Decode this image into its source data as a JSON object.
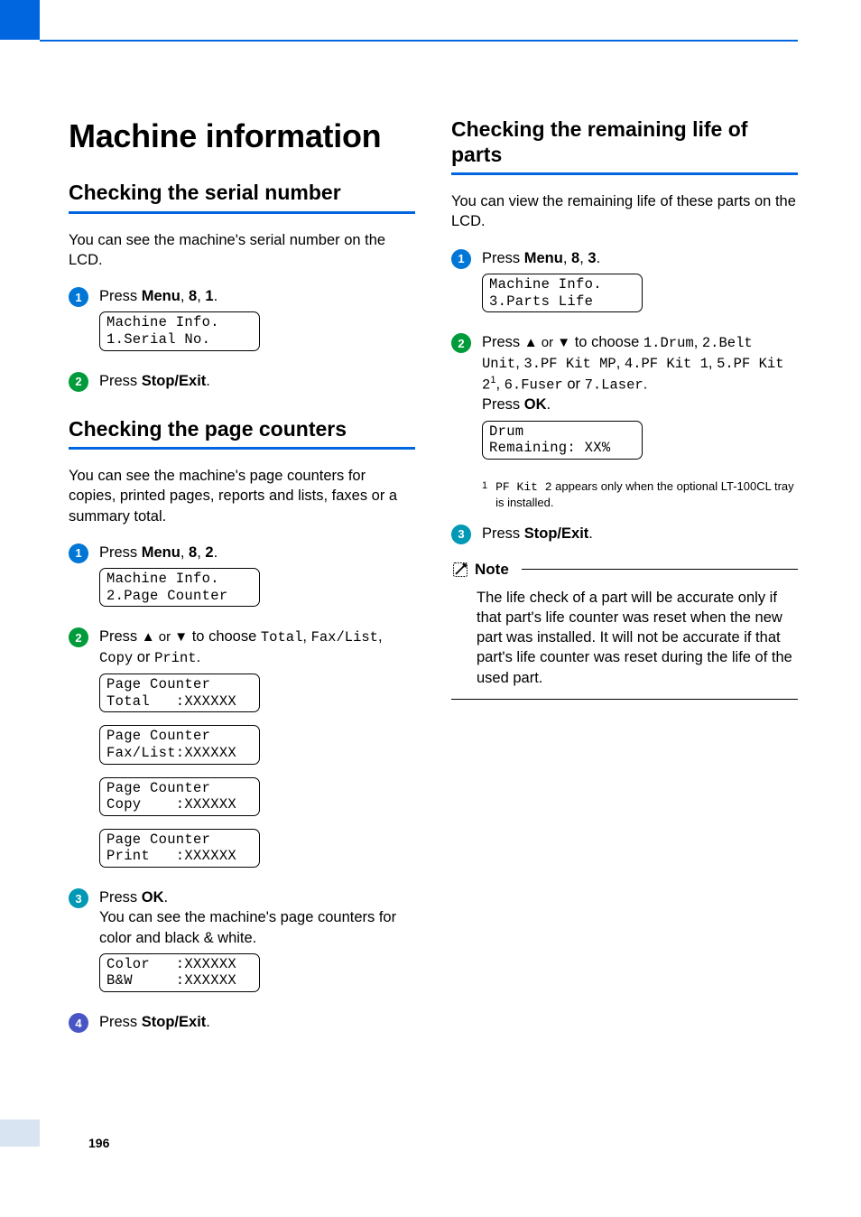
{
  "pageNumber": "196",
  "left": {
    "h1": "Machine information",
    "section1": {
      "title": "Checking the serial number",
      "intro": "You can see the machine's serial number on the LCD.",
      "step1_pre": "Press ",
      "step1_b1": "Menu",
      "step1_mid1": ", ",
      "step1_b2": "8",
      "step1_mid2": ", ",
      "step1_b3": "1",
      "step1_post": ".",
      "lcd1": "Machine Info.\n1.Serial No.",
      "step2_pre": "Press ",
      "step2_b": "Stop/Exit",
      "step2_post": "."
    },
    "section2": {
      "title": "Checking the page counters",
      "intro": "You can see the machine's page counters for copies, printed pages, reports and lists, faxes or a summary total.",
      "s1_pre": "Press ",
      "s1_b1": "Menu",
      "s1_m1": ", ",
      "s1_b2": "8",
      "s1_m2": ", ",
      "s1_b3": "2",
      "s1_post": ".",
      "lcd1": "Machine Info.\n2.Page Counter",
      "s2_pre": "Press ",
      "s2_arrows": "▲ or ▼",
      "s2_mid": " to choose ",
      "s2_o1": "Total",
      "s2_c1": ", ",
      "s2_o2": "Fax/List",
      "s2_c2": ", ",
      "s2_o3": "Copy",
      "s2_or": " or ",
      "s2_o4": "Print",
      "s2_post": ".",
      "lcd2": "Page Counter\nTotal   :XXXXXX",
      "lcd3": "Page Counter\nFax/List:XXXXXX",
      "lcd4": "Page Counter\nCopy    :XXXXXX",
      "lcd5": "Page Counter\nPrint   :XXXXXX",
      "s3_pre": "Press ",
      "s3_b": "OK",
      "s3_post": ".",
      "s3_line2": "You can see the machine's page counters for color and black & white.",
      "lcd6": "Color   :XXXXXX\nB&W     :XXXXXX",
      "s4_pre": "Press ",
      "s4_b": "Stop/Exit",
      "s4_post": "."
    }
  },
  "right": {
    "section": {
      "title": "Checking the remaining life of parts",
      "intro": "You can view the remaining life of these parts on the LCD.",
      "s1_pre": "Press ",
      "s1_b1": "Menu",
      "s1_m1": ", ",
      "s1_b2": "8",
      "s1_m2": ", ",
      "s1_b3": "3",
      "s1_post": ".",
      "lcd1": "Machine Info.\n3.Parts Life",
      "s2_pre": "Press ",
      "s2_arrows": "▲ or ▼",
      "s2_mid": " to choose ",
      "s2_o1": "1.Drum",
      "s2_c1": ", ",
      "s2_o2": "2.Belt Unit",
      "s2_c2": ", ",
      "s2_o3": "3.PF Kit MP",
      "s2_c3": ", ",
      "s2_o4": "4.PF Kit 1",
      "s2_c4": ", ",
      "s2_o5": "5.PF Kit 2",
      "s2_sup": "1",
      "s2_c5": ", ",
      "s2_o6": "6.Fuser",
      "s2_or": " or ",
      "s2_o7": "7.Laser",
      "s2_post": ".",
      "s2_press_pre": "Press ",
      "s2_press_b": "OK",
      "s2_press_post": ".",
      "lcd2": "Drum\nRemaining: XX%",
      "fn_num": "1",
      "fn_txt_mono": "PF Kit 2",
      "fn_txt_rest": " appears only when the optional LT-100CL tray is installed.",
      "s3_pre": "Press ",
      "s3_b": "Stop/Exit",
      "s3_post": "."
    },
    "note": {
      "label": "Note",
      "body": "The life check of a part will be accurate only if that part's life counter was reset when the new part was installed. It will not be accurate if that part's life counter was reset during the life of the used part."
    }
  }
}
